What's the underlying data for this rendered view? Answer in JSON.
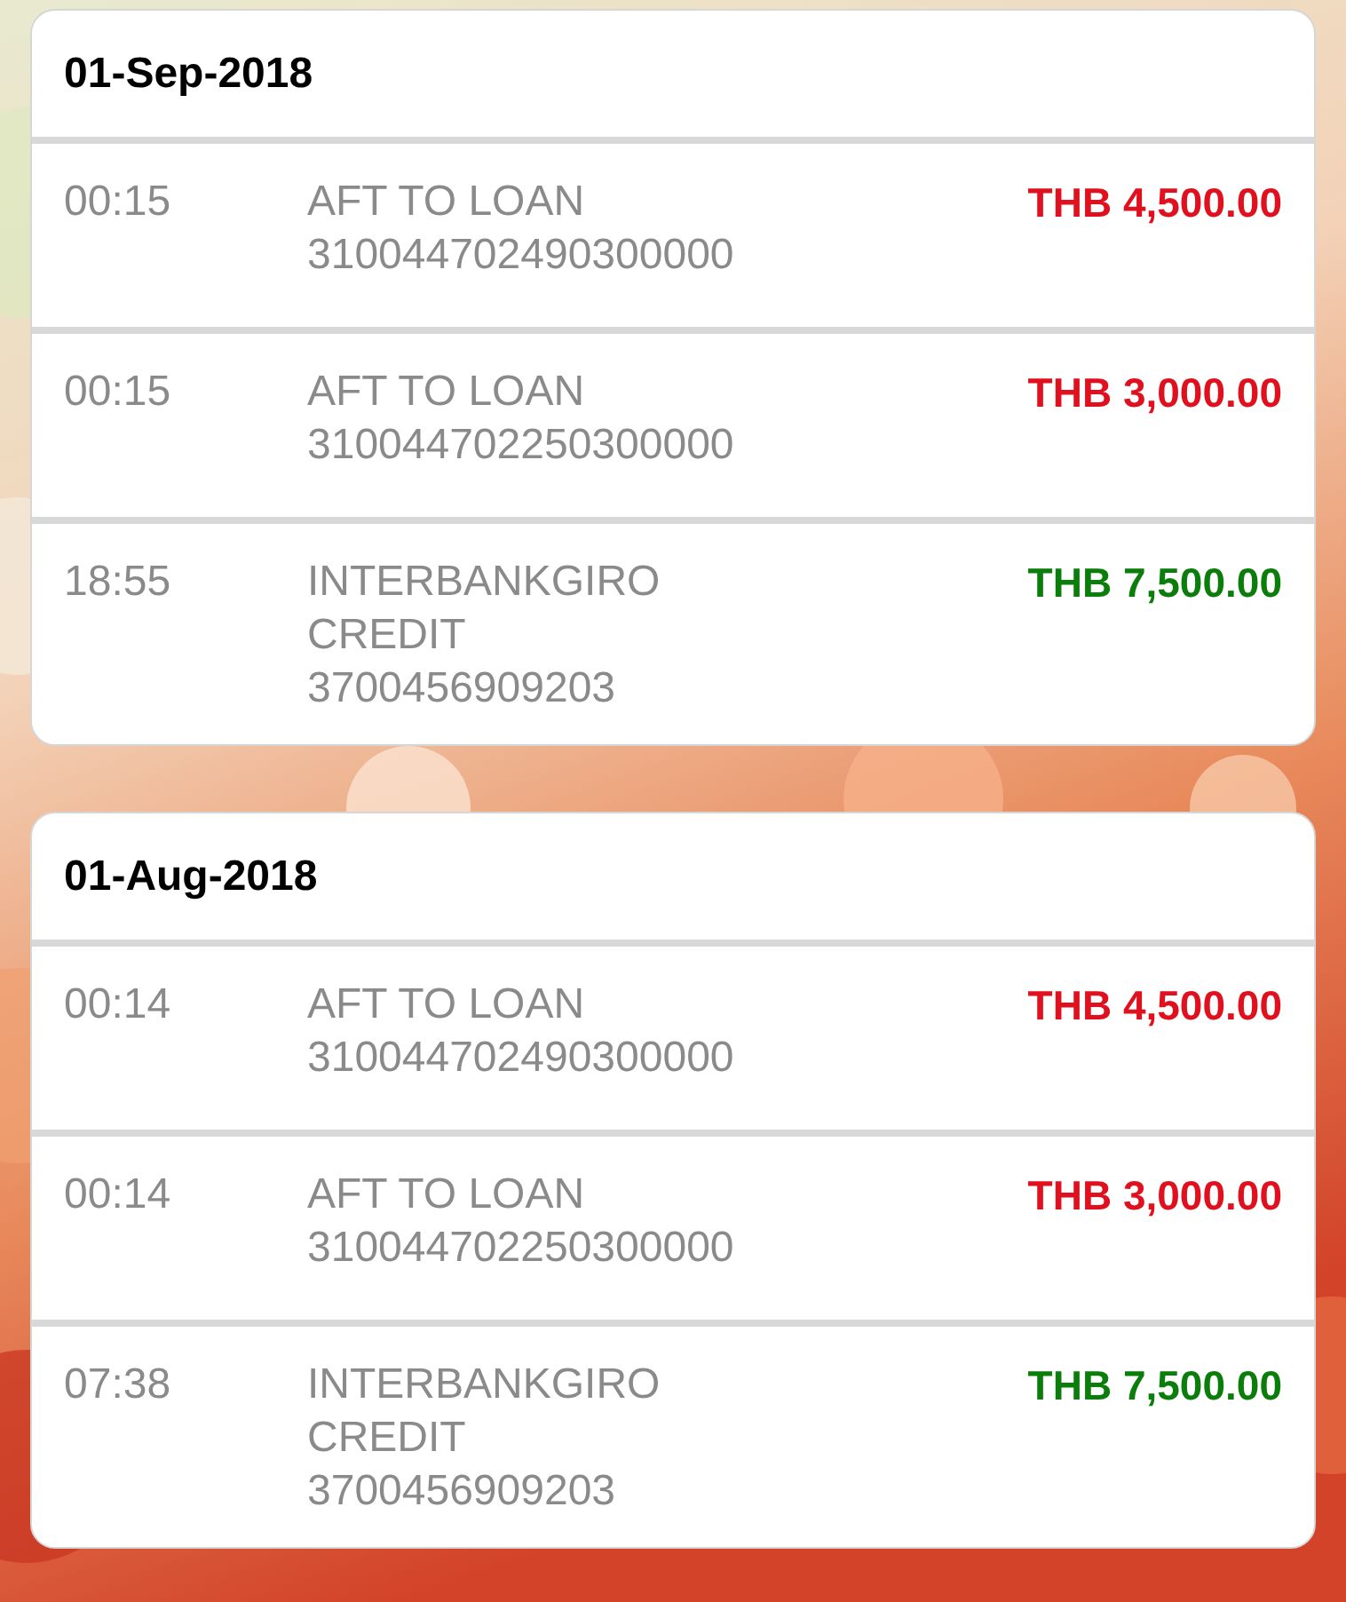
{
  "groups": [
    {
      "date": "01-Sep-2018",
      "transactions": [
        {
          "time": "00:15",
          "lines": [
            "AFT TO LOAN",
            "310044702490300000"
          ],
          "amount": "THB 4,500.00",
          "kind": "debit"
        },
        {
          "time": "00:15",
          "lines": [
            "AFT TO LOAN",
            "310044702250300000"
          ],
          "amount": "THB 3,000.00",
          "kind": "debit"
        },
        {
          "time": "18:55",
          "lines": [
            "INTERBANKGIRO",
            "CREDIT",
            "3700456909203"
          ],
          "amount": "THB 7,500.00",
          "kind": "credit"
        }
      ]
    },
    {
      "date": "01-Aug-2018",
      "transactions": [
        {
          "time": "00:14",
          "lines": [
            "AFT TO LOAN",
            "310044702490300000"
          ],
          "amount": "THB 4,500.00",
          "kind": "debit"
        },
        {
          "time": "00:14",
          "lines": [
            "AFT TO LOAN",
            "310044702250300000"
          ],
          "amount": "THB 3,000.00",
          "kind": "debit"
        },
        {
          "time": "07:38",
          "lines": [
            "INTERBANKGIRO",
            "CREDIT",
            "3700456909203"
          ],
          "amount": "THB 7,500.00",
          "kind": "credit"
        }
      ]
    }
  ]
}
